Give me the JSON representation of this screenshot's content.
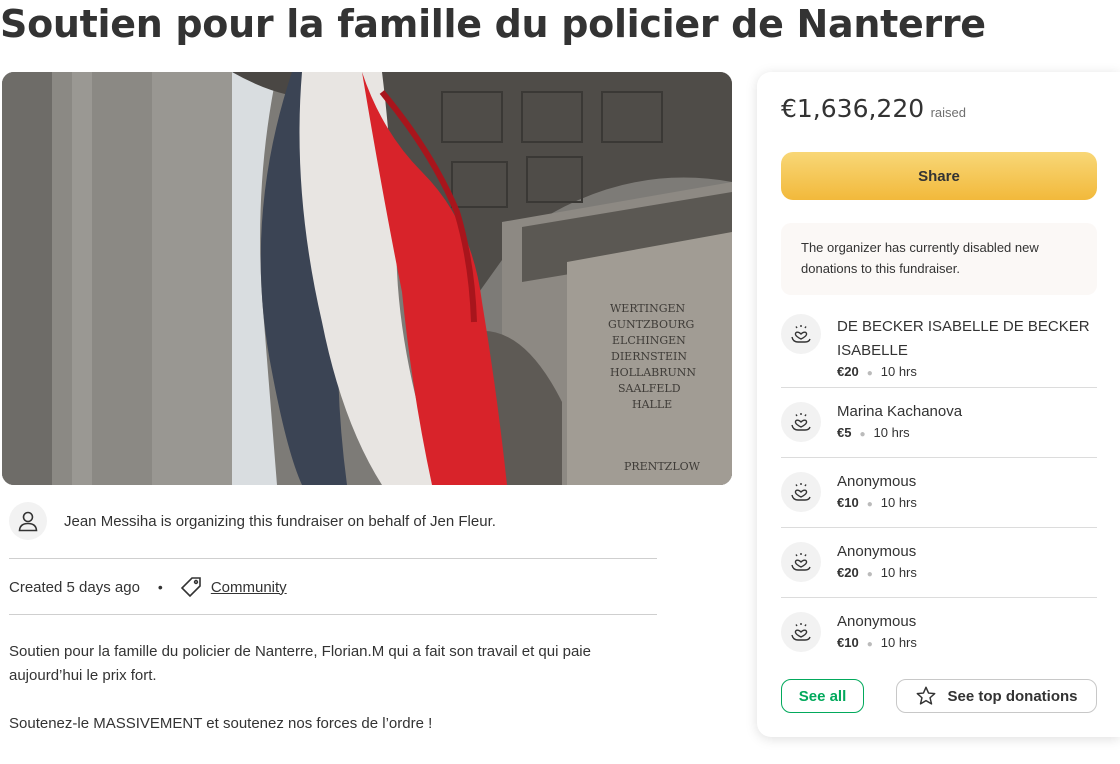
{
  "page": {
    "title": "Soutien pour la famille du policier de Nanterre"
  },
  "organizer": {
    "text": "Jean Messiha is organizing this fundraiser on behalf of Jen Fleur.",
    "avatar_icon": "user-icon"
  },
  "meta": {
    "created": "Created 5 days ago",
    "separator": "•",
    "category": "Community",
    "category_icon": "tag-icon"
  },
  "description": {
    "paragraphs": [
      "Soutien pour la famille du policier de Nanterre, Florian.M qui a fait son travail et qui paie aujourd’hui le prix fort.",
      "Soutenez-le MASSIVEMENT et soutenez nos forces de l’ordre !"
    ]
  },
  "hero": {
    "inscription": [
      "WERTINGEN",
      "GUNTZBOURG",
      "ELCHINGEN",
      "DIERNSTEIN",
      "HOLLABRUNN",
      "SAALFELD",
      "HALLE",
      "",
      "PRENTZLOW"
    ]
  },
  "summary": {
    "amount": "€1,636,220",
    "raised_label": "raised",
    "share_label": "Share",
    "notice": "The organizer has currently disabled new donations to this fundraiser."
  },
  "donations": [
    {
      "name": "DE BECKER ISABELLE DE BECKER ISABELLE",
      "amount": "€20",
      "time": "10 hrs",
      "icon": "donation-heart-icon"
    },
    {
      "name": "Marina Kachanova",
      "amount": "€5",
      "time": "10 hrs",
      "icon": "donation-heart-icon"
    },
    {
      "name": "Anonymous",
      "amount": "€10",
      "time": "10 hrs",
      "icon": "donation-heart-icon"
    },
    {
      "name": "Anonymous",
      "amount": "€20",
      "time": "10 hrs",
      "icon": "donation-heart-icon"
    },
    {
      "name": "Anonymous",
      "amount": "€10",
      "time": "10 hrs",
      "icon": "donation-heart-icon"
    }
  ],
  "buttons": {
    "see_all": "See all",
    "top_donations": "See top donations",
    "top_donations_icon": "star-icon"
  },
  "colors": {
    "accent_green": "#02a95c",
    "share_yellow": "#f2b93b",
    "flag_red": "#d8232a",
    "notice_bg": "#fbf8f6"
  }
}
